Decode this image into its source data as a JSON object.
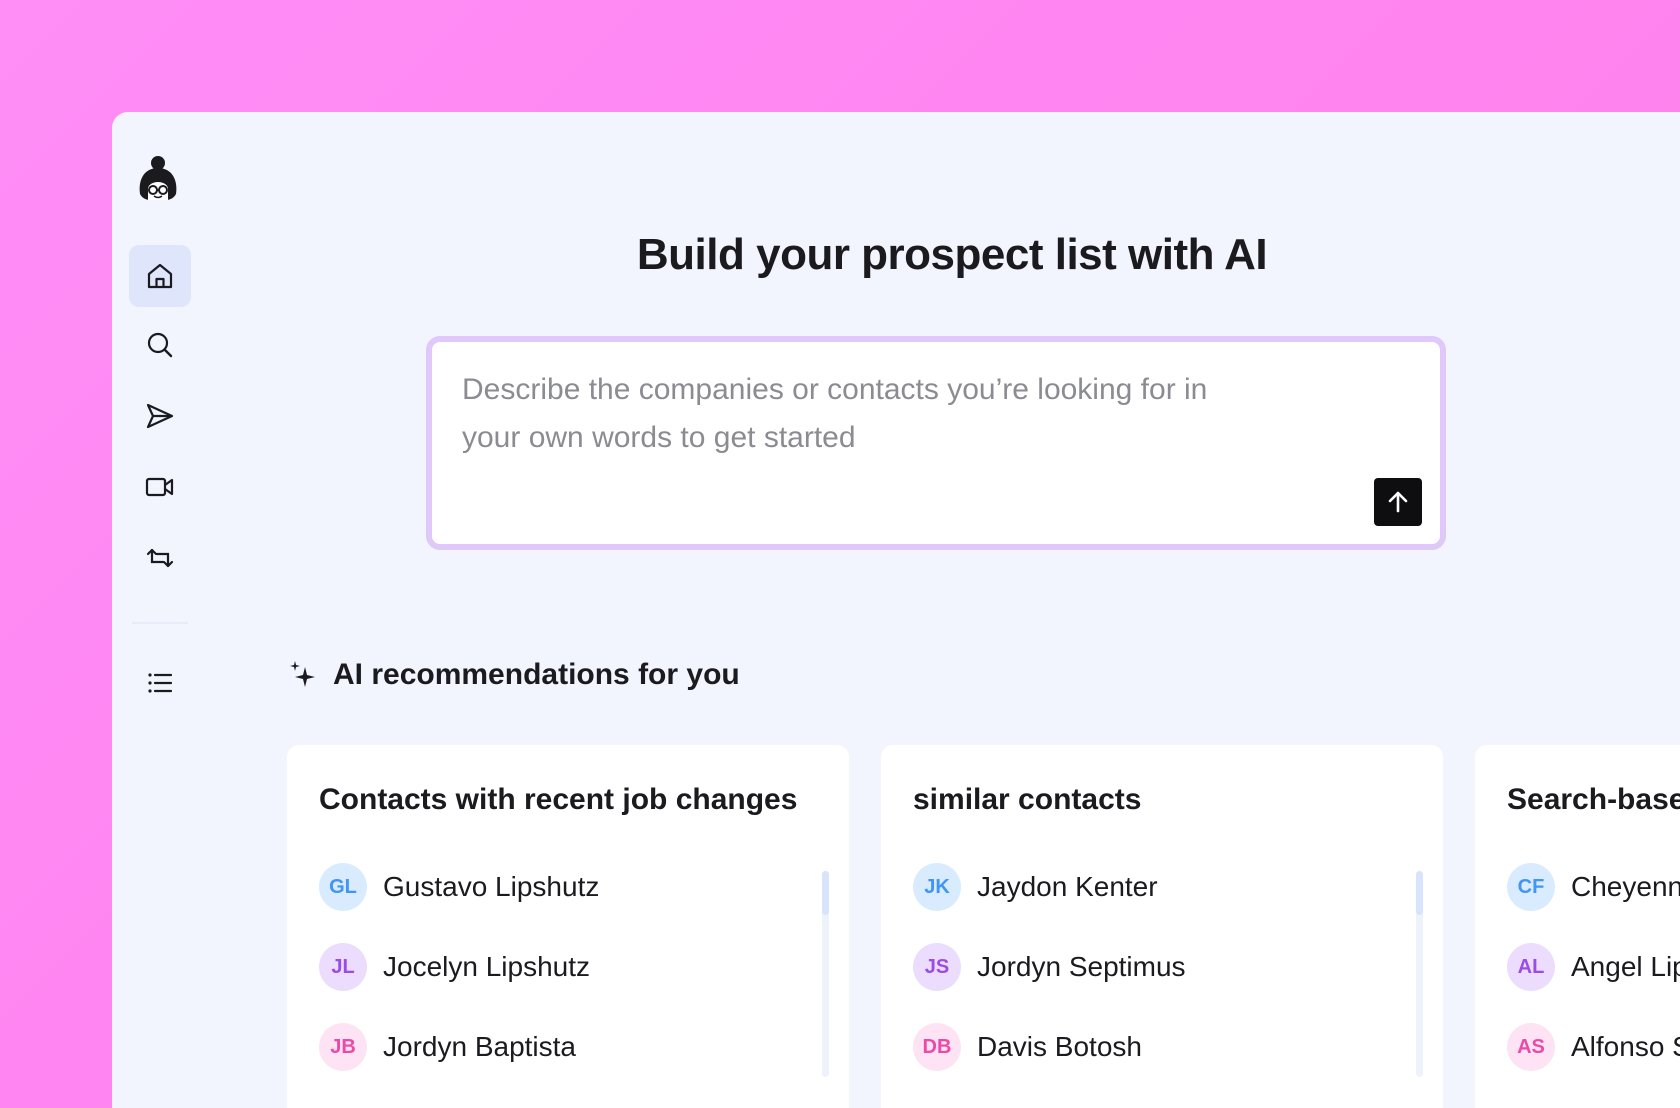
{
  "sidebar": {
    "nav": [
      {
        "icon": "home-icon",
        "active": true
      },
      {
        "icon": "search-icon",
        "active": false
      },
      {
        "icon": "send-icon",
        "active": false
      },
      {
        "icon": "video-icon",
        "active": false
      },
      {
        "icon": "repeat-icon",
        "active": false
      },
      {
        "icon": "list-icon",
        "active": false
      }
    ]
  },
  "main": {
    "title": "Build your prospect list with AI",
    "prompt": {
      "placeholder": "Describe the companies or contacts you’re looking for in your own words to get started",
      "value": ""
    },
    "recommendations": {
      "heading": "AI recommendations for you",
      "icon": "sparkle-icon",
      "cards": [
        {
          "title": "Contacts with recent job changes",
          "contacts": [
            {
              "initials": "GL",
              "name": "Gustavo Lipshutz",
              "color": "blue"
            },
            {
              "initials": "JL",
              "name": "Jocelyn Lipshutz",
              "color": "purple"
            },
            {
              "initials": "JB",
              "name": "Jordyn Baptista",
              "color": "pink"
            }
          ]
        },
        {
          "title": "similar contacts",
          "contacts": [
            {
              "initials": "JK",
              "name": "Jaydon Kenter",
              "color": "blue"
            },
            {
              "initials": "JS",
              "name": "Jordyn Septimus",
              "color": "purple"
            },
            {
              "initials": "DB",
              "name": "Davis Botosh",
              "color": "pink"
            }
          ]
        },
        {
          "title": "Search-base",
          "contacts": [
            {
              "initials": "CF",
              "name": "Cheyenn",
              "color": "blue"
            },
            {
              "initials": "AL",
              "name": "Angel Lip",
              "color": "purple"
            },
            {
              "initials": "AS",
              "name": "Alfonso S",
              "color": "pink"
            }
          ]
        }
      ]
    }
  },
  "colors": {
    "background": "#ff8ef7",
    "app_bg": "#f2f5fe",
    "prompt_border": "#e0c8fb",
    "send_button": "#0e0e10",
    "avatar_blue": "#4196f5",
    "avatar_purple": "#9a4ce6",
    "avatar_pink": "#ec4aa9"
  }
}
